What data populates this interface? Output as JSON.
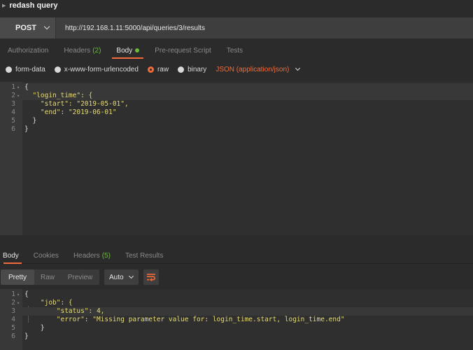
{
  "window": {
    "title": "redash query"
  },
  "request": {
    "method": "POST",
    "url": "http://192.168.1.11:5000/api/queries/3/results",
    "tabs": [
      {
        "label": "Authorization"
      },
      {
        "label": "Headers",
        "count": "(2)"
      },
      {
        "label": "Body"
      },
      {
        "label": "Pre-request Script"
      },
      {
        "label": "Tests"
      }
    ],
    "active_tab": "Body",
    "body_options": [
      "form-data",
      "x-www-form-urlencoded",
      "raw",
      "binary"
    ],
    "selected_body_option": "raw",
    "content_type": "JSON (application/json)",
    "lines": [
      {
        "no": "1",
        "fold": "▾",
        "text": "{"
      },
      {
        "no": "2",
        "fold": "▾",
        "text": "  \"login_time\": {"
      },
      {
        "no": "3",
        "fold": "",
        "text": "    \"start\": \"2019-05-01\","
      },
      {
        "no": "4",
        "fold": "",
        "text": "    \"end\": \"2019-06-01\""
      },
      {
        "no": "5",
        "fold": "",
        "text": "  }"
      },
      {
        "no": "6",
        "fold": "",
        "text": "}"
      }
    ]
  },
  "response": {
    "tabs": [
      {
        "label": "Body"
      },
      {
        "label": "Cookies"
      },
      {
        "label": "Headers",
        "count": "(5)"
      },
      {
        "label": "Test Results"
      }
    ],
    "active_tab": "Body",
    "view_modes": [
      "Pretty",
      "Raw",
      "Preview"
    ],
    "active_view_mode": "Pretty",
    "format": "Auto",
    "lines": [
      {
        "no": "1",
        "fold": "▾",
        "text": "{"
      },
      {
        "no": "2",
        "fold": "▾",
        "text": "    \"job\": {"
      },
      {
        "no": "3",
        "fold": "",
        "text": "        \"status\": 4,"
      },
      {
        "no": "4",
        "fold": "",
        "text": "        \"error\": \"Missing parameter value for: login_time.start, login_time.end\""
      },
      {
        "no": "5",
        "fold": "",
        "text": "    }"
      },
      {
        "no": "6",
        "fold": "",
        "text": "}"
      }
    ]
  },
  "colors": {
    "accent": "#f26b3a",
    "count_green": "#6cbb3c",
    "string_yellow": "#e6db74",
    "number_purple": "#c58fe0"
  },
  "icons": {
    "collapse_caret": "caret-right-icon",
    "method_dropdown": "chevron-down-icon",
    "content_type_dropdown": "chevron-down-icon",
    "wrap_toggle": "wrap-lines-icon"
  }
}
